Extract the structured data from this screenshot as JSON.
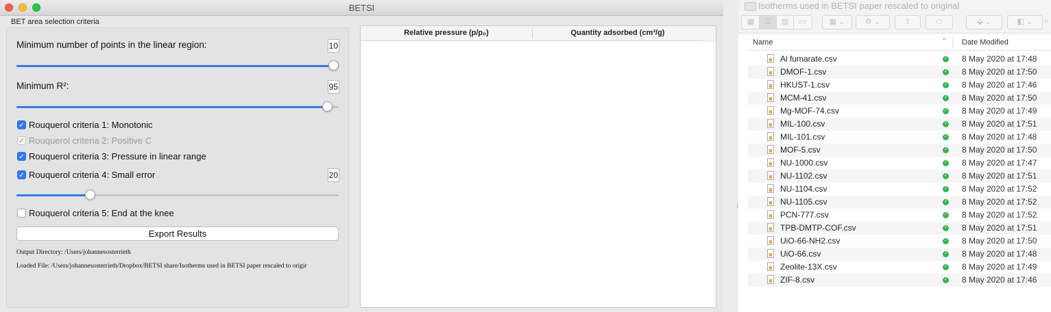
{
  "window": {
    "title": "BETSI"
  },
  "panel": {
    "group_label": "BET area selection criteria",
    "min_points_label": "Minimum number of points in the linear region:",
    "min_points_value": "10",
    "min_points_slider": 1.0,
    "min_r2_label": "Minimum R²:",
    "min_r2_value": "95",
    "min_r2_slider": 0.98,
    "criteria": [
      {
        "label": "Rouquerol criteria 1: Monotonic",
        "checked": true,
        "enabled": true
      },
      {
        "label": "Rouquerol criteria 2: Positive C",
        "checked": true,
        "enabled": false
      },
      {
        "label": "Rouquerol criteria 3: Pressure in linear range",
        "checked": true,
        "enabled": true
      },
      {
        "label": "Rouquerol criteria 4: Small error",
        "checked": true,
        "enabled": true
      },
      {
        "label": "Rouquerol criteria 5: End at the knee",
        "checked": false,
        "enabled": true
      }
    ],
    "small_error_value": "20",
    "small_error_slider": 0.22,
    "export_label": "Export Results",
    "output_directory": "Output Directory: /Users/johannesosterrieth",
    "loaded_file": "Loaded File: /Users/johannesosterrieth/Dropbox/BETSI share/Isotherms used in BETSI paper rescaled to origir"
  },
  "table": {
    "headers": [
      "Relative pressure (p/p₀)",
      "Quantity adsorbed (cm³/g)"
    ]
  },
  "finder": {
    "title": "Isotherms used in BETSI paper rescaled to original",
    "columns": {
      "name": "Name",
      "date": "Date Modified"
    },
    "files": [
      {
        "name": "Al fumarate.csv",
        "date": "8 May 2020 at 17:48"
      },
      {
        "name": "DMOF-1.csv",
        "date": "8 May 2020 at 17:50"
      },
      {
        "name": "HKUST-1.csv",
        "date": "8 May 2020 at 17:46"
      },
      {
        "name": "MCM-41.csv",
        "date": "8 May 2020 at 17:50"
      },
      {
        "name": "Mg-MOF-74.csv",
        "date": "8 May 2020 at 17:49"
      },
      {
        "name": "MIL-100.csv",
        "date": "8 May 2020 at 17:51"
      },
      {
        "name": "MIL-101.csv",
        "date": "8 May 2020 at 17:48"
      },
      {
        "name": "MOF-5.csv",
        "date": "8 May 2020 at 17:50"
      },
      {
        "name": "NU-1000.csv",
        "date": "8 May 2020 at 17:47"
      },
      {
        "name": "NU-1102.csv",
        "date": "8 May 2020 at 17:51"
      },
      {
        "name": "NU-1104.csv",
        "date": "8 May 2020 at 17:52"
      },
      {
        "name": "NU-1105.csv",
        "date": "8 May 2020 at 17:52"
      },
      {
        "name": "PCN-777.csv",
        "date": "8 May 2020 at 17:52"
      },
      {
        "name": "TPB-DMTP-COF.csv",
        "date": "8 May 2020 at 17:51"
      },
      {
        "name": "UiO-66-NH2.csv",
        "date": "8 May 2020 at 17:50"
      },
      {
        "name": "UiO-66.csv",
        "date": "8 May 2020 at 17:48"
      },
      {
        "name": "Zeolite-13X.csv",
        "date": "8 May 2020 at 17:49"
      },
      {
        "name": "ZIF-8.csv",
        "date": "8 May 2020 at 17:46"
      }
    ]
  },
  "colors": {
    "accent": "#2f7cf6",
    "slider_track": "#c4c4c4",
    "sync_green": "#33b552"
  }
}
